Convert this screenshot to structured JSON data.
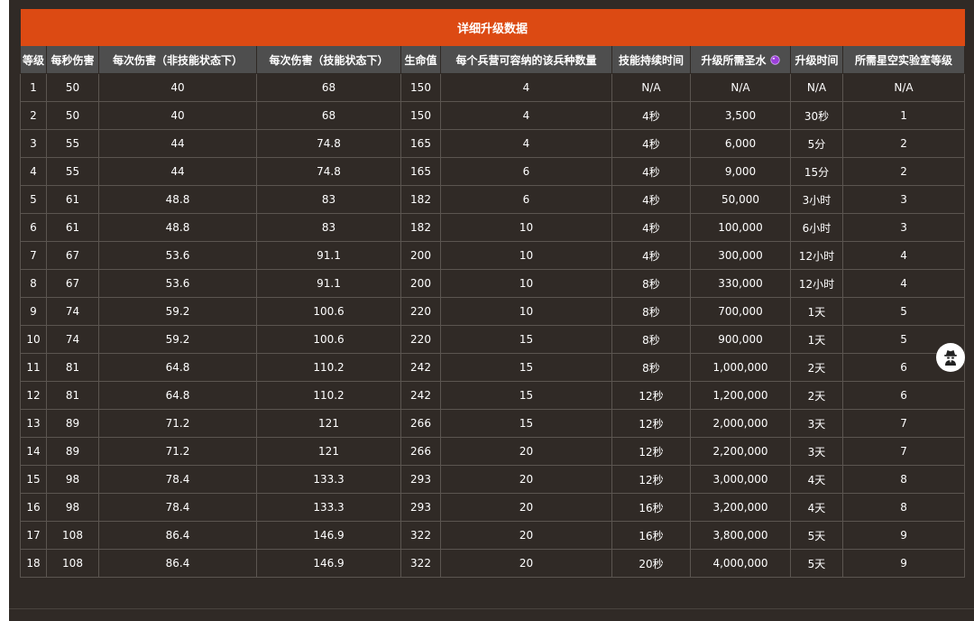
{
  "table": {
    "title": "详细升级数据",
    "headers": [
      "等级",
      "每秒伤害",
      "每次伤害（非技能状态下）",
      "每次伤害（技能状态下）",
      "生命值",
      "每个兵营可容纳的该兵种数量",
      "技能持续时间",
      "升级所需圣水",
      "升级时间",
      "所需星空实验室等级"
    ],
    "elixir_icon": "elixir-drop-icon",
    "elixir_color": "#9b3fd8",
    "rows": [
      [
        "1",
        "50",
        "40",
        "68",
        "150",
        "4",
        "N/A",
        "N/A",
        "N/A",
        "N/A"
      ],
      [
        "2",
        "50",
        "40",
        "68",
        "150",
        "4",
        "4秒",
        "3,500",
        "30秒",
        "1"
      ],
      [
        "3",
        "55",
        "44",
        "74.8",
        "165",
        "4",
        "4秒",
        "6,000",
        "5分",
        "2"
      ],
      [
        "4",
        "55",
        "44",
        "74.8",
        "165",
        "6",
        "4秒",
        "9,000",
        "15分",
        "2"
      ],
      [
        "5",
        "61",
        "48.8",
        "83",
        "182",
        "6",
        "4秒",
        "50,000",
        "3小时",
        "3"
      ],
      [
        "6",
        "61",
        "48.8",
        "83",
        "182",
        "10",
        "4秒",
        "100,000",
        "6小时",
        "3"
      ],
      [
        "7",
        "67",
        "53.6",
        "91.1",
        "200",
        "10",
        "4秒",
        "300,000",
        "12小时",
        "4"
      ],
      [
        "8",
        "67",
        "53.6",
        "91.1",
        "200",
        "10",
        "8秒",
        "330,000",
        "12小时",
        "4"
      ],
      [
        "9",
        "74",
        "59.2",
        "100.6",
        "220",
        "10",
        "8秒",
        "700,000",
        "1天",
        "5"
      ],
      [
        "10",
        "74",
        "59.2",
        "100.6",
        "220",
        "15",
        "8秒",
        "900,000",
        "1天",
        "5"
      ],
      [
        "11",
        "81",
        "64.8",
        "110.2",
        "242",
        "15",
        "8秒",
        "1,000,000",
        "2天",
        "6"
      ],
      [
        "12",
        "81",
        "64.8",
        "110.2",
        "242",
        "15",
        "12秒",
        "1,200,000",
        "2天",
        "6"
      ],
      [
        "13",
        "89",
        "71.2",
        "121",
        "266",
        "15",
        "12秒",
        "2,000,000",
        "3天",
        "7"
      ],
      [
        "14",
        "89",
        "71.2",
        "121",
        "266",
        "20",
        "12秒",
        "2,200,000",
        "3天",
        "7"
      ],
      [
        "15",
        "98",
        "78.4",
        "133.3",
        "293",
        "20",
        "12秒",
        "3,000,000",
        "4天",
        "8"
      ],
      [
        "16",
        "98",
        "78.4",
        "133.3",
        "293",
        "20",
        "16秒",
        "3,200,000",
        "4天",
        "8"
      ],
      [
        "17",
        "108",
        "86.4",
        "146.9",
        "322",
        "20",
        "16秒",
        "3,800,000",
        "5天",
        "9"
      ],
      [
        "18",
        "108",
        "86.4",
        "146.9",
        "322",
        "20",
        "20秒",
        "4,000,000",
        "5天",
        "9"
      ]
    ]
  },
  "floating_button": {
    "icon": "spy-icon"
  },
  "colors": {
    "title_bar": "#dc4a13",
    "header_row": "#4e4e4e",
    "background": "#302a26"
  }
}
